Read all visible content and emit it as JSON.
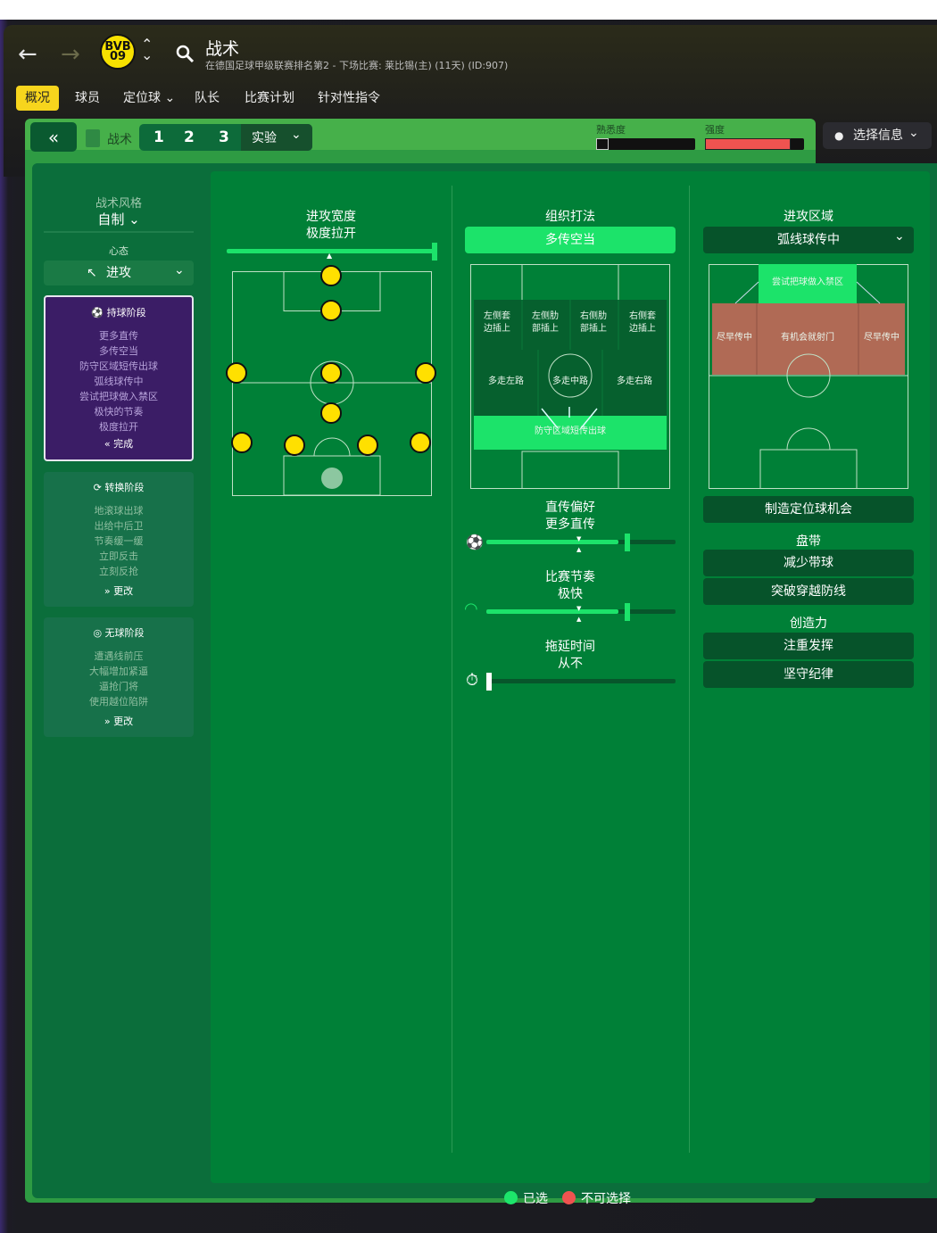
{
  "header": {
    "title": "战术",
    "subtitle": "在德国足球甲级联赛排名第2 - 下场比赛: 莱比锡(主) (11天) (ID:907)",
    "crest_text": "BVB 09"
  },
  "tabs": [
    {
      "label": "概况",
      "active": true
    },
    {
      "label": "球员"
    },
    {
      "label": "定位球 ⌄"
    },
    {
      "label": "队长"
    },
    {
      "label": "比赛计划"
    },
    {
      "label": "针对性指令"
    }
  ],
  "toolbar": {
    "tactic_label": "战术",
    "slots": [
      "1",
      "2",
      "3"
    ],
    "mode": "实验",
    "familiarity_label": "熟悉度",
    "intensity_label": "强度",
    "select_info": "选择信息"
  },
  "left": {
    "style_label": "战术风格",
    "style_value": "自制",
    "mentality_label": "心态",
    "mentality_value": "进攻",
    "in_possession": {
      "title": "持球阶段",
      "items": [
        "更多直传",
        "多传空当",
        "防守区域短传出球",
        "弧线球传中",
        "尝试把球做入禁区",
        "极快的节奏",
        "极度拉开"
      ],
      "action": "完成"
    },
    "transition": {
      "title": "转换阶段",
      "items": [
        "地滚球出球",
        "出给中后卫",
        "节奏缓一缓",
        "立即反击",
        "立刻反抢"
      ],
      "action": "更改"
    },
    "out_possession": {
      "title": "无球阶段",
      "items": [
        "遭遇线前压",
        "大幅增加紧逼",
        "逼抢门将",
        "使用越位陷阱"
      ],
      "action": "更改"
    }
  },
  "col1": {
    "title": "进攻宽度",
    "value": "极度拉开",
    "width_level": 1.0
  },
  "col2": {
    "title": "组织打法",
    "button": "多传空当",
    "zones_top": [
      "左侧套\n边插上",
      "左侧肋\n部插上",
      "右侧肋\n部插上",
      "右侧套\n边插上"
    ],
    "zones_mid": [
      "多走左路",
      "多走中路",
      "多走右路"
    ],
    "zone_bottom": "防守区域短传出球",
    "passing_title": "直传偏好",
    "passing_value": "更多直传",
    "passing_level": 0.7,
    "tempo_title": "比赛节奏",
    "tempo_value": "极快",
    "tempo_level": 0.7,
    "time_title": "拖延时间",
    "time_value": "从不",
    "time_level": 0.0
  },
  "col3": {
    "title": "进攻区域",
    "dropdown": "弧线球传中",
    "zone_top": "尝试把球做入禁区",
    "zones_row": [
      "尽早传中",
      "有机会就射门",
      "尽早传中"
    ],
    "set_pieces_btn": "制造定位球机会",
    "dribbling_title": "盘带",
    "dribbling_btns": [
      "减少带球",
      "突破穿越防线"
    ],
    "creativity_title": "创造力",
    "creativity_btns": [
      "注重发挥",
      "坚守纪律"
    ]
  },
  "legend": {
    "selected": "已选",
    "unavailable": "不可选择"
  },
  "colors": {
    "selected": "#1de56b",
    "unavailable": "#ef5350",
    "accent": "#f7d51d"
  }
}
